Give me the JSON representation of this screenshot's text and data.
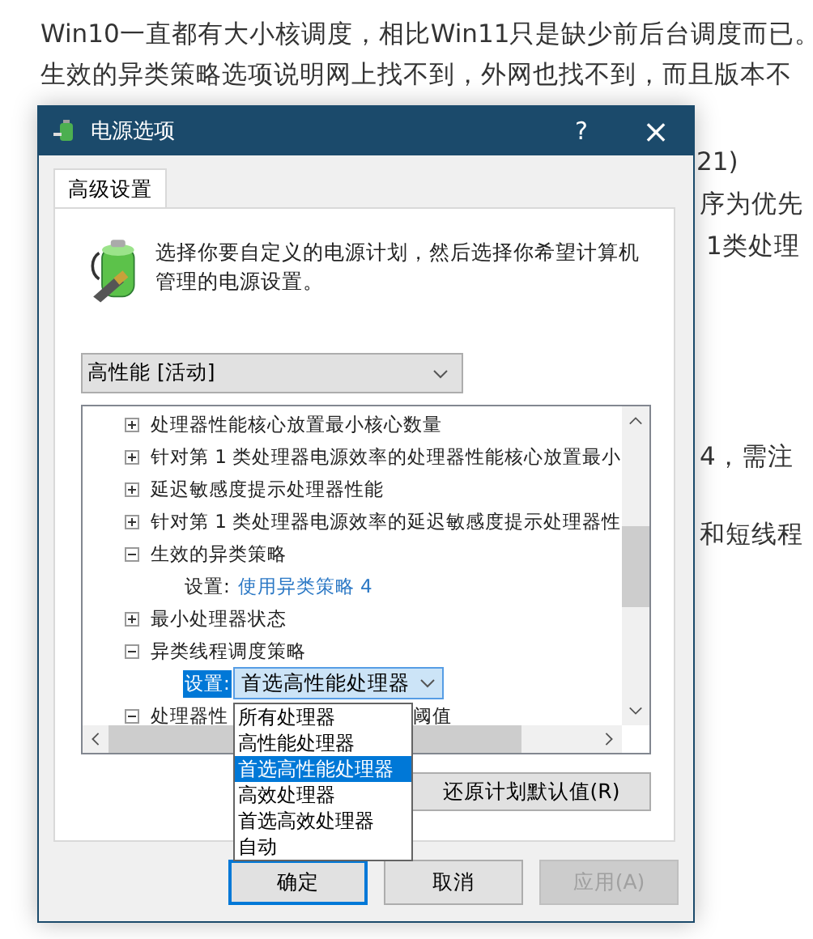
{
  "article": {
    "lines": [
      "Win10一直都有大小核调度，相比Win11只是缺少前后台调度而已。",
      "生效的异类策略选项说明网上找不到，外网也找不到，而且版本不"
    ],
    "fragments": [
      "21)",
      "序为优先",
      "1类处理",
      "4，需注",
      "和短线程"
    ]
  },
  "window": {
    "title": "电源选项",
    "help": "?",
    "close": "×"
  },
  "tabs": [
    {
      "label": "高级设置",
      "selected": true
    }
  ],
  "description": "选择你要自定义的电源计划，然后选择你希望计算机管理的电源设置。",
  "plan_select": {
    "value": "高性能 [活动]"
  },
  "tree": {
    "rows": [
      {
        "label": "处理器性能核心放置最小核心数量",
        "expanded": false
      },
      {
        "label": "针对第 1 类处理器电源效率的处理器性能核心放置最小",
        "expanded": false
      },
      {
        "label": "延迟敏感度提示处理器性能",
        "expanded": false
      },
      {
        "label": "针对第 1 类处理器电源效率的延迟敏感度提示处理器性",
        "expanded": false
      },
      {
        "label": "生效的异类策略",
        "expanded": true,
        "children": [
          {
            "kind": "link",
            "label": "设置:",
            "value": "使用异类策略 4"
          }
        ]
      },
      {
        "label": "最小处理器状态",
        "expanded": false
      },
      {
        "label": "异类线程调度策略",
        "expanded": true,
        "children": [
          {
            "kind": "select",
            "label": "设置:",
            "value": "首选高性能处理器"
          }
        ]
      },
      {
        "label": "处理器性",
        "label_tail": "阈值",
        "expanded": true
      }
    ]
  },
  "dropdown_list": {
    "options": [
      {
        "label": "所有处理器",
        "selected": false
      },
      {
        "label": "高性能处理器",
        "selected": false
      },
      {
        "label": "首选高性能处理器",
        "selected": true
      },
      {
        "label": "高效处理器",
        "selected": false
      },
      {
        "label": "首选高效处理器",
        "selected": false
      },
      {
        "label": "自动",
        "selected": false
      }
    ]
  },
  "restore_button": "还原计划默认值(R)",
  "buttons": [
    {
      "label": "确定",
      "kind": "default",
      "disabled": false
    },
    {
      "label": "取消",
      "kind": "normal",
      "disabled": false
    },
    {
      "label": "应用(A)",
      "kind": "normal",
      "disabled": true
    }
  ]
}
